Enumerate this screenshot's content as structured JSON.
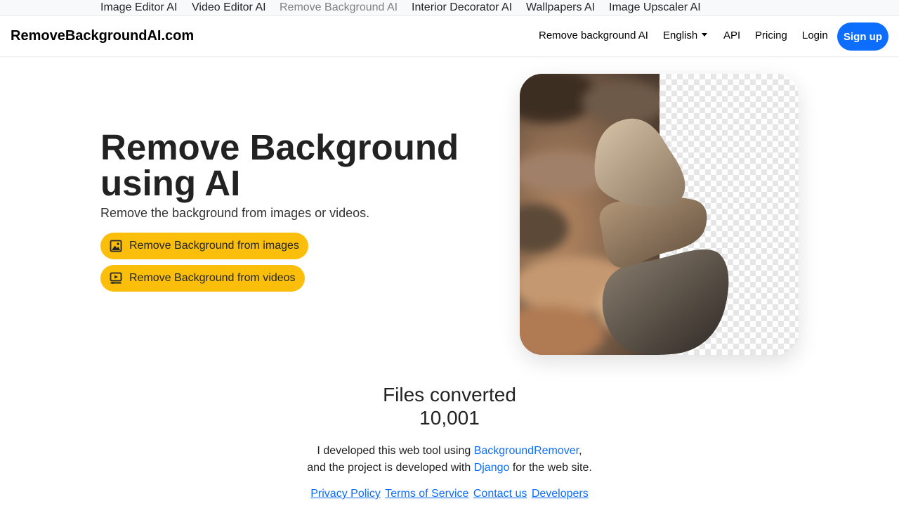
{
  "top_strip": {
    "items": [
      {
        "label": "Image Editor AI"
      },
      {
        "label": "Video Editor AI"
      },
      {
        "label": "Remove Background AI"
      },
      {
        "label": "Interior Decorator AI"
      },
      {
        "label": "Wallpapers AI"
      },
      {
        "label": "Image Upscaler AI"
      }
    ]
  },
  "navbar": {
    "brand": "RemoveBackgroundAI.com",
    "links": {
      "remove_background": "Remove background AI",
      "language": "English",
      "api": "API",
      "pricing": "Pricing",
      "login": "Login",
      "signup": "Sign up"
    }
  },
  "hero": {
    "title": "Remove Background using AI",
    "subtitle": "Remove the background from images or videos.",
    "buttons": {
      "images": "Remove Background from images",
      "videos": "Remove Background from videos"
    },
    "icons": {
      "images": "image-icon",
      "videos": "video-icon"
    }
  },
  "stats": {
    "label": "Files converted",
    "value": "10,001"
  },
  "credits": {
    "line1_prefix": "I developed this web tool using ",
    "line1_link": "BackgroundRemover",
    "line1_suffix": ",",
    "line2_prefix": "and the project is developed with ",
    "line2_link": "Django",
    "line2_suffix": " for the web site."
  },
  "footer": {
    "links": [
      "Privacy Policy",
      "Terms of Service",
      "Contact us",
      "Developers"
    ]
  },
  "colors": {
    "accent": "#0d6efd",
    "cta": "#fbbf0b"
  }
}
